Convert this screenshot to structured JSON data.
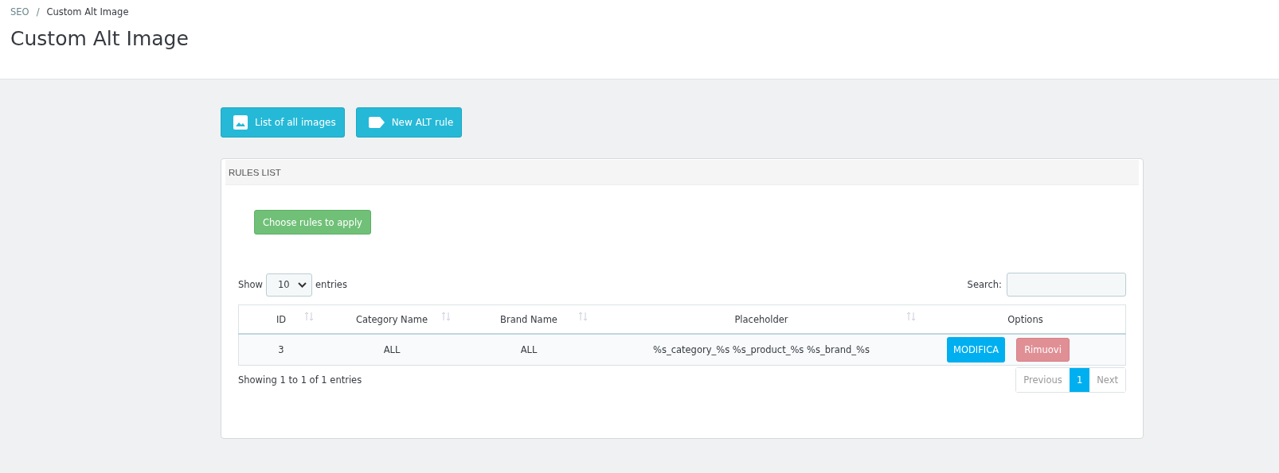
{
  "breadcrumb": {
    "items": [
      "SEO",
      "Custom Alt Image"
    ],
    "separator": "/"
  },
  "page_title": "Custom Alt Image",
  "toolbar": [
    "List of all images",
    "New ALT rule"
  ],
  "panel": {
    "title": "RULES LIST",
    "action_button": "Choose rules to apply",
    "length": {
      "before": "Show",
      "value": "10",
      "after": "entries"
    },
    "search": {
      "label": "Search:"
    },
    "table": {
      "columns": [
        {
          "label": "ID",
          "sortable": true
        },
        {
          "label": "Category Name",
          "sortable": true
        },
        {
          "label": "Brand Name",
          "sortable": true
        },
        {
          "label": "Placeholder",
          "sortable": true
        },
        {
          "label": "Options",
          "sortable": false
        }
      ],
      "rows": [
        {
          "id": "3",
          "category": "ALL",
          "brand": "ALL",
          "placeholder": "%s_category_%s %s_product_%s %s_brand_%s",
          "edit": "MODIFICA",
          "remove": "Rimuovi"
        }
      ]
    },
    "info": "Showing 1 to 1 of 1 entries",
    "pagination": [
      {
        "label": "Previous",
        "selected": false
      },
      {
        "label": "1",
        "selected": true
      },
      {
        "label": "Next",
        "selected": false
      }
    ]
  }
}
